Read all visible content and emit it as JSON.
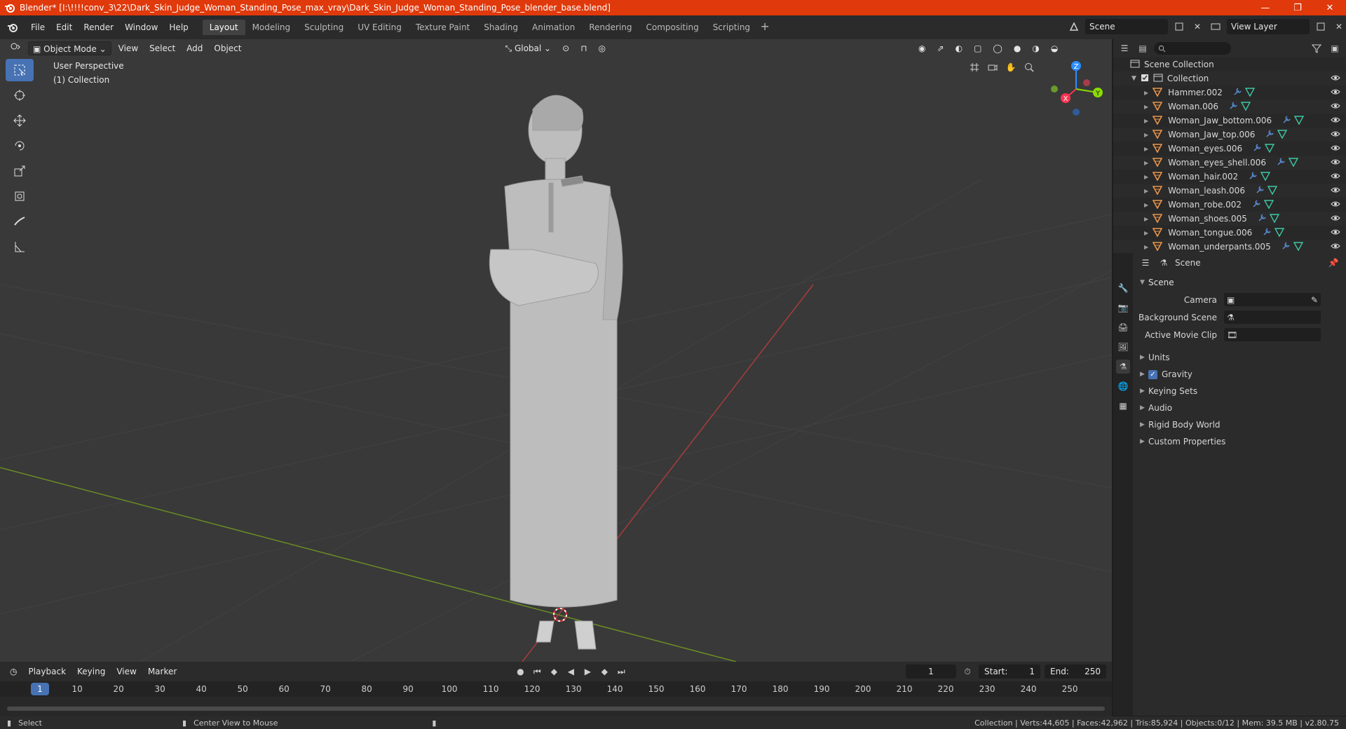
{
  "window": {
    "title": "Blender* [I:\\!!!!conv_3\\22\\Dark_Skin_Judge_Woman_Standing_Pose_max_vray\\Dark_Skin_Judge_Woman_Standing_Pose_blender_base.blend]",
    "minimize": "—",
    "maximize": "❐",
    "close": "✕"
  },
  "menu": [
    "File",
    "Edit",
    "Render",
    "Window",
    "Help"
  ],
  "workspaces": [
    "Layout",
    "Modeling",
    "Sculpting",
    "UV Editing",
    "Texture Paint",
    "Shading",
    "Animation",
    "Rendering",
    "Compositing",
    "Scripting"
  ],
  "active_workspace": "Layout",
  "scene_selector": "Scene",
  "view_layer_selector": "View Layer",
  "viewport": {
    "mode": "Object Mode",
    "menus": [
      "View",
      "Select",
      "Add",
      "Object"
    ],
    "orientation": "Global",
    "info_line1": "User Perspective",
    "info_line2": "(1) Collection",
    "gizmo": {
      "x": "X",
      "y": "Y",
      "z": "Z"
    }
  },
  "outliner": {
    "scene_collection": "Scene Collection",
    "collection": "Collection",
    "items": [
      "Hammer.002",
      "Woman.006",
      "Woman_Jaw_bottom.006",
      "Woman_Jaw_top.006",
      "Woman_eyes.006",
      "Woman_eyes_shell.006",
      "Woman_hair.002",
      "Woman_leash.006",
      "Woman_robe.002",
      "Woman_shoes.005",
      "Woman_tongue.006",
      "Woman_underpants.005"
    ]
  },
  "properties": {
    "header": "Scene",
    "panel": "Scene",
    "camera_label": "Camera",
    "background_scene_label": "Background Scene",
    "active_movie_clip_label": "Active Movie Clip",
    "subpanels": [
      "Units",
      "Gravity",
      "Keying Sets",
      "Audio",
      "Rigid Body World",
      "Custom Properties"
    ],
    "gravity_checked": true
  },
  "timeline": {
    "menus": [
      "Playback",
      "Keying",
      "View",
      "Marker"
    ],
    "current_frame": "1",
    "start_label": "Start:",
    "start": "1",
    "end_label": "End:",
    "end": "250",
    "ticks": [
      "1",
      "10",
      "20",
      "30",
      "40",
      "50",
      "60",
      "70",
      "80",
      "90",
      "100",
      "110",
      "120",
      "130",
      "140",
      "150",
      "160",
      "170",
      "180",
      "190",
      "200",
      "210",
      "220",
      "230",
      "240",
      "250"
    ]
  },
  "statusbar": {
    "left1": "Select",
    "left2": "Center View to Mouse",
    "right": "Collection | Verts:44,605 | Faces:42,962 | Tris:85,924 | Objects:0/12 | Mem: 39.5 MB | v2.80.75"
  },
  "colors": {
    "titlebar": "#e0390b",
    "viewport_bg": "#393939",
    "accent": "#4772b3",
    "axis_x": "#ff3352",
    "axis_y": "#8bdc00",
    "axis_z": "#2c8fff",
    "object_icon": "#e8954a"
  }
}
